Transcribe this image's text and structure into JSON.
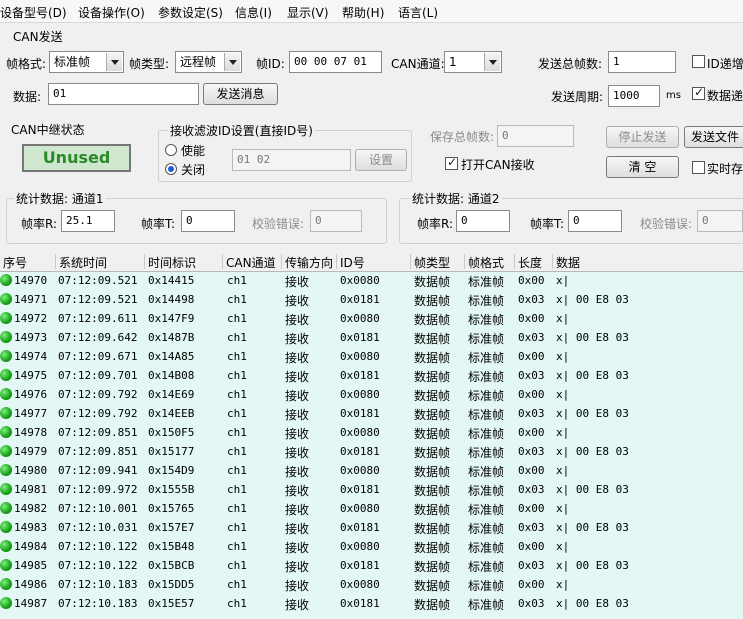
{
  "menu": [
    "设备型号(D)",
    "设备操作(O)",
    "参数设定(S)",
    "信息(I)",
    "显示(V)",
    "帮助(H)",
    "语言(L)"
  ],
  "can_send": {
    "section_title": "CAN发送",
    "frame_format_label": "帧格式:",
    "frame_format_value": "标准帧",
    "frame_type_label": "帧类型:",
    "frame_type_value": "远程帧",
    "frame_id_label": "帧ID:",
    "frame_id_value": "00 00 07 01",
    "channel_label": "CAN通道:",
    "channel_value": "1",
    "total_frames_label": "发送总帧数:",
    "total_frames_value": "1",
    "id_increment_label": "ID递增",
    "data_label": "数据:",
    "data_value": "01",
    "send_button": "发送消息",
    "period_label": "发送周期:",
    "period_value": "1000",
    "period_unit": "ms",
    "data_increment_label": "数据递"
  },
  "relay": {
    "title": "CAN中继状态",
    "status": "Unused"
  },
  "filter": {
    "title": "接收滤波ID设置(直接ID号)",
    "enable_label": "使能",
    "disable_label": "关闭",
    "id_value": "01 02",
    "set_button": "设置"
  },
  "save": {
    "total_label": "保存总帧数:",
    "total_value": "0",
    "open_receive_label": "打开CAN接收",
    "stop_button": "停止发送",
    "send_file_button": "发送文件",
    "clear_button": "清 空",
    "realtime_label": "实时存"
  },
  "stats1": {
    "title": "统计数据: 通道1",
    "rate_r_label": "帧率R:",
    "rate_r_value": "25.1",
    "rate_t_label": "帧率T:",
    "rate_t_value": "0",
    "crc_label": "校验错误:",
    "crc_value": "0"
  },
  "stats2": {
    "title": "统计数据: 通道2",
    "rate_r_label": "帧率R:",
    "rate_r_value": "0",
    "rate_t_label": "帧率T:",
    "rate_t_value": "0",
    "crc_label": "校验错误:",
    "crc_value": "0"
  },
  "table": {
    "columns": [
      "序号",
      "系统时间",
      "时间标识",
      "CAN通道",
      "传输方向",
      "ID号",
      "帧类型",
      "帧格式",
      "长度",
      "数据"
    ],
    "rows": [
      [
        "14970",
        "07:12:09.521",
        "0x14415",
        "ch1",
        "接收",
        "0x0080",
        "数据帧",
        "标准帧",
        "0x00",
        "x|"
      ],
      [
        "14971",
        "07:12:09.521",
        "0x14498",
        "ch1",
        "接收",
        "0x0181",
        "数据帧",
        "标准帧",
        "0x03",
        "x| 00 E8 03"
      ],
      [
        "14972",
        "07:12:09.611",
        "0x147F9",
        "ch1",
        "接收",
        "0x0080",
        "数据帧",
        "标准帧",
        "0x00",
        "x|"
      ],
      [
        "14973",
        "07:12:09.642",
        "0x1487B",
        "ch1",
        "接收",
        "0x0181",
        "数据帧",
        "标准帧",
        "0x03",
        "x| 00 E8 03"
      ],
      [
        "14974",
        "07:12:09.671",
        "0x14A85",
        "ch1",
        "接收",
        "0x0080",
        "数据帧",
        "标准帧",
        "0x00",
        "x|"
      ],
      [
        "14975",
        "07:12:09.701",
        "0x14B08",
        "ch1",
        "接收",
        "0x0181",
        "数据帧",
        "标准帧",
        "0x03",
        "x| 00 E8 03"
      ],
      [
        "14976",
        "07:12:09.792",
        "0x14E69",
        "ch1",
        "接收",
        "0x0080",
        "数据帧",
        "标准帧",
        "0x00",
        "x|"
      ],
      [
        "14977",
        "07:12:09.792",
        "0x14EEB",
        "ch1",
        "接收",
        "0x0181",
        "数据帧",
        "标准帧",
        "0x03",
        "x| 00 E8 03"
      ],
      [
        "14978",
        "07:12:09.851",
        "0x150F5",
        "ch1",
        "接收",
        "0x0080",
        "数据帧",
        "标准帧",
        "0x00",
        "x|"
      ],
      [
        "14979",
        "07:12:09.851",
        "0x15177",
        "ch1",
        "接收",
        "0x0181",
        "数据帧",
        "标准帧",
        "0x03",
        "x| 00 E8 03"
      ],
      [
        "14980",
        "07:12:09.941",
        "0x154D9",
        "ch1",
        "接收",
        "0x0080",
        "数据帧",
        "标准帧",
        "0x00",
        "x|"
      ],
      [
        "14981",
        "07:12:09.972",
        "0x1555B",
        "ch1",
        "接收",
        "0x0181",
        "数据帧",
        "标准帧",
        "0x03",
        "x| 00 E8 03"
      ],
      [
        "14982",
        "07:12:10.001",
        "0x15765",
        "ch1",
        "接收",
        "0x0080",
        "数据帧",
        "标准帧",
        "0x00",
        "x|"
      ],
      [
        "14983",
        "07:12:10.031",
        "0x157E7",
        "ch1",
        "接收",
        "0x0181",
        "数据帧",
        "标准帧",
        "0x03",
        "x| 00 E8 03"
      ],
      [
        "14984",
        "07:12:10.122",
        "0x15B48",
        "ch1",
        "接收",
        "0x0080",
        "数据帧",
        "标准帧",
        "0x00",
        "x|"
      ],
      [
        "14985",
        "07:12:10.122",
        "0x15BCB",
        "ch1",
        "接收",
        "0x0181",
        "数据帧",
        "标准帧",
        "0x03",
        "x| 00 E8 03"
      ],
      [
        "14986",
        "07:12:10.183",
        "0x15DD5",
        "ch1",
        "接收",
        "0x0080",
        "数据帧",
        "标准帧",
        "0x00",
        "x|"
      ],
      [
        "14987",
        "07:12:10.183",
        "0x15E57",
        "ch1",
        "接收",
        "0x0181",
        "数据帧",
        "标准帧",
        "0x03",
        "x| 00 E8 03"
      ]
    ]
  }
}
